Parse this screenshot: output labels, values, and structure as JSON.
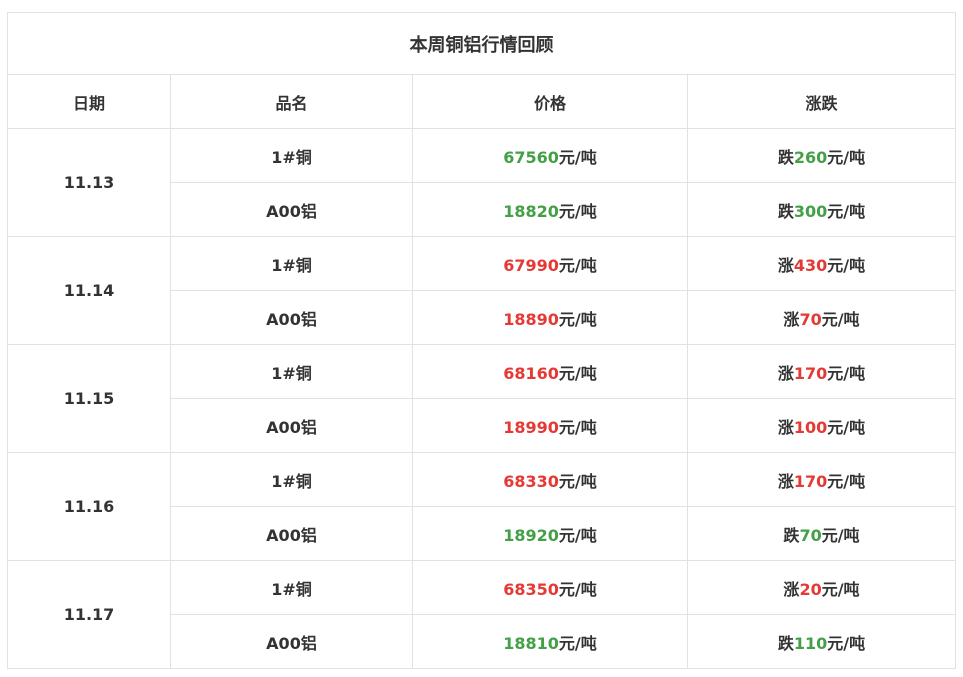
{
  "title": "本周铜铝行情回顾",
  "headers": {
    "date": "日期",
    "name": "品名",
    "price": "价格",
    "change": "涨跌"
  },
  "unit": "元/吨",
  "colors": {
    "down": "#43a047",
    "up": "#e53935",
    "text": "#333333"
  },
  "days": [
    {
      "date": "11.13",
      "rows": [
        {
          "name": "1#铜",
          "price": "67560",
          "dir": "跌",
          "delta": "260",
          "trend": "down"
        },
        {
          "name": "A00铝",
          "price": "18820",
          "dir": "跌",
          "delta": "300",
          "trend": "down"
        }
      ]
    },
    {
      "date": "11.14",
      "rows": [
        {
          "name": "1#铜",
          "price": "67990",
          "dir": "涨",
          "delta": "430",
          "trend": "up"
        },
        {
          "name": "A00铝",
          "price": "18890",
          "dir": "涨",
          "delta": "70",
          "trend": "up"
        }
      ]
    },
    {
      "date": "11.15",
      "rows": [
        {
          "name": "1#铜",
          "price": "68160",
          "dir": "涨",
          "delta": "170",
          "trend": "up"
        },
        {
          "name": "A00铝",
          "price": "18990",
          "dir": "涨",
          "delta": "100",
          "trend": "up"
        }
      ]
    },
    {
      "date": "11.16",
      "rows": [
        {
          "name": "1#铜",
          "price": "68330",
          "dir": "涨",
          "delta": "170",
          "trend": "up"
        },
        {
          "name": "A00铝",
          "price": "18920",
          "dir": "跌",
          "delta": "70",
          "trend": "down"
        }
      ]
    },
    {
      "date": "11.17",
      "rows": [
        {
          "name": "1#铜",
          "price": "68350",
          "dir": "涨",
          "delta": "20",
          "trend": "up"
        },
        {
          "name": "A00铝",
          "price": "18810",
          "dir": "跌",
          "delta": "110",
          "trend": "down"
        }
      ]
    }
  ]
}
